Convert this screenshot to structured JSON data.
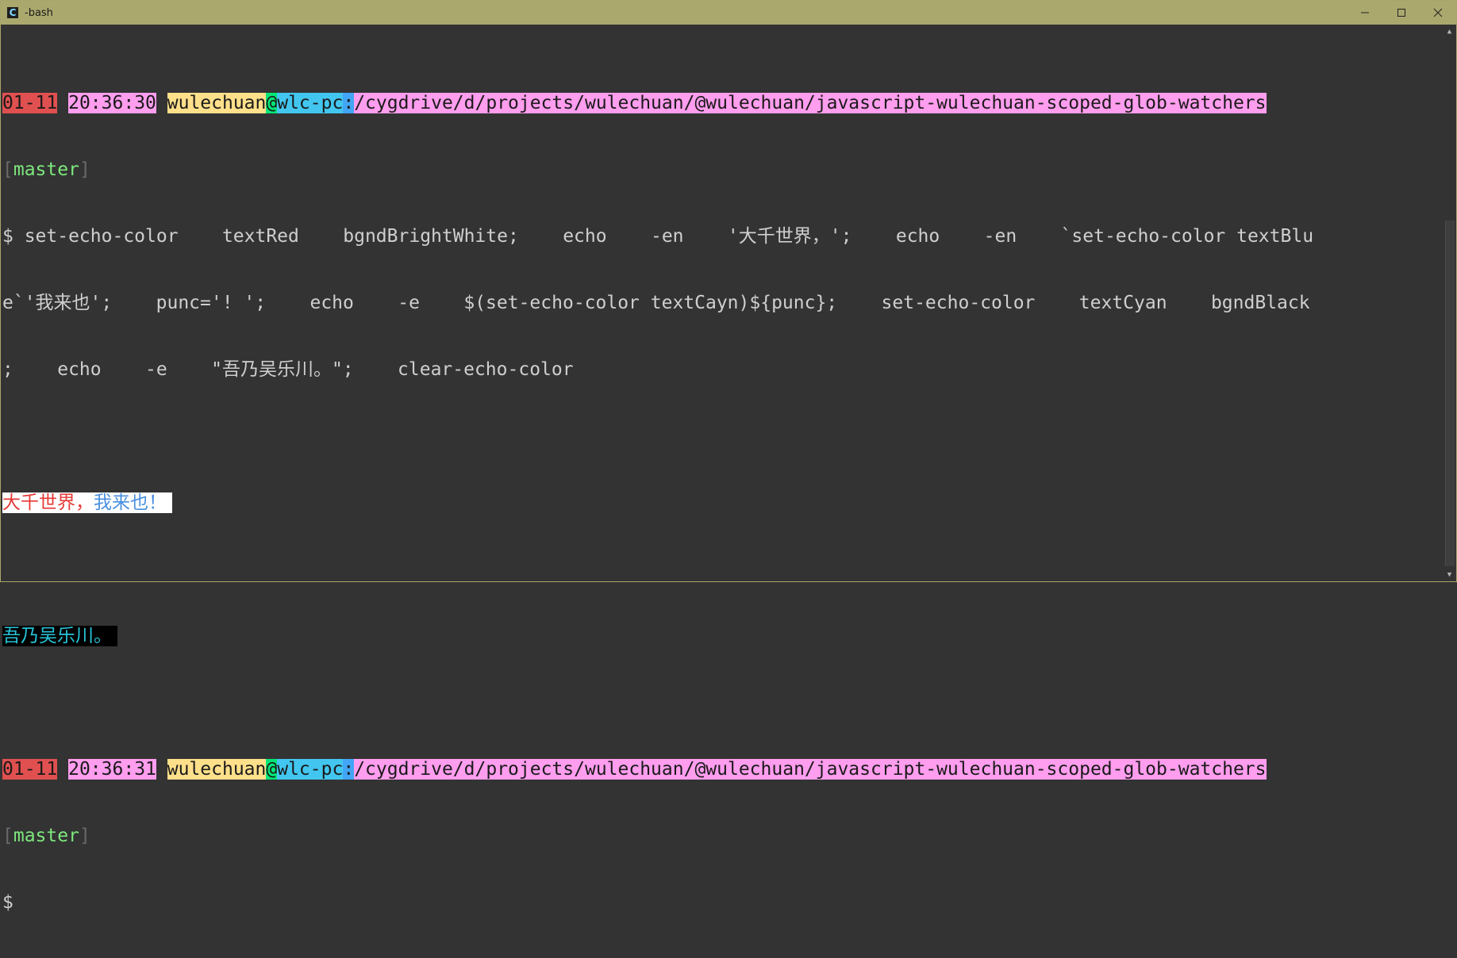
{
  "window": {
    "title": "-bash",
    "icon": "cygwin-terminal-icon",
    "controls": [
      "minimize-icon",
      "maximize-icon",
      "close-icon"
    ]
  },
  "prompt1": {
    "date": "01-11",
    "time": "20:36:30",
    "user": "wulechuan",
    "at": "@",
    "host": "wlc-pc",
    "colon": ":",
    "path": "/cygdrive/d/projects/wulechuan/@wulechuan/javascript-wulechuan-scoped-glob-watchers",
    "bracket_open": "[",
    "branch": "master",
    "bracket_close": "]"
  },
  "command": {
    "line1": "$ set-echo-color    textRed    bgndBrightWhite;    echo    -en    '大千世界，';    echo    -en    `set-echo-color textBlu",
    "line2": "e`'我来也';    punc='! ';    echo    -e    $(set-echo-color textCayn)${punc};    set-echo-color    textCyan    bgndBlack",
    "line3": ";    echo    -e    \"吾乃吴乐川。\";    clear-echo-color"
  },
  "output": {
    "red_text": "大千世界，",
    "blue_text": "我来也！",
    "cyan_text": "吾乃吴乐川。"
  },
  "prompt2": {
    "date": "01-11",
    "time": "20:36:31",
    "user": "wulechuan",
    "at": "@",
    "host": "wlc-pc",
    "colon": ":",
    "path": "/cygdrive/d/projects/wulechuan/@wulechuan/javascript-wulechuan-scoped-glob-watchers",
    "bracket_open": "[",
    "branch": "master",
    "bracket_close": "]",
    "dollar": "$"
  },
  "colors": {
    "titlebar": "#aaa86d",
    "background": "#333333",
    "date_bg": "#e05050",
    "time_bg": "#ff9dee",
    "user_bg": "#ffe08a",
    "at_bg": "#00e676",
    "host_bg": "#42c6f0",
    "branch_fg": "#7de87d"
  }
}
